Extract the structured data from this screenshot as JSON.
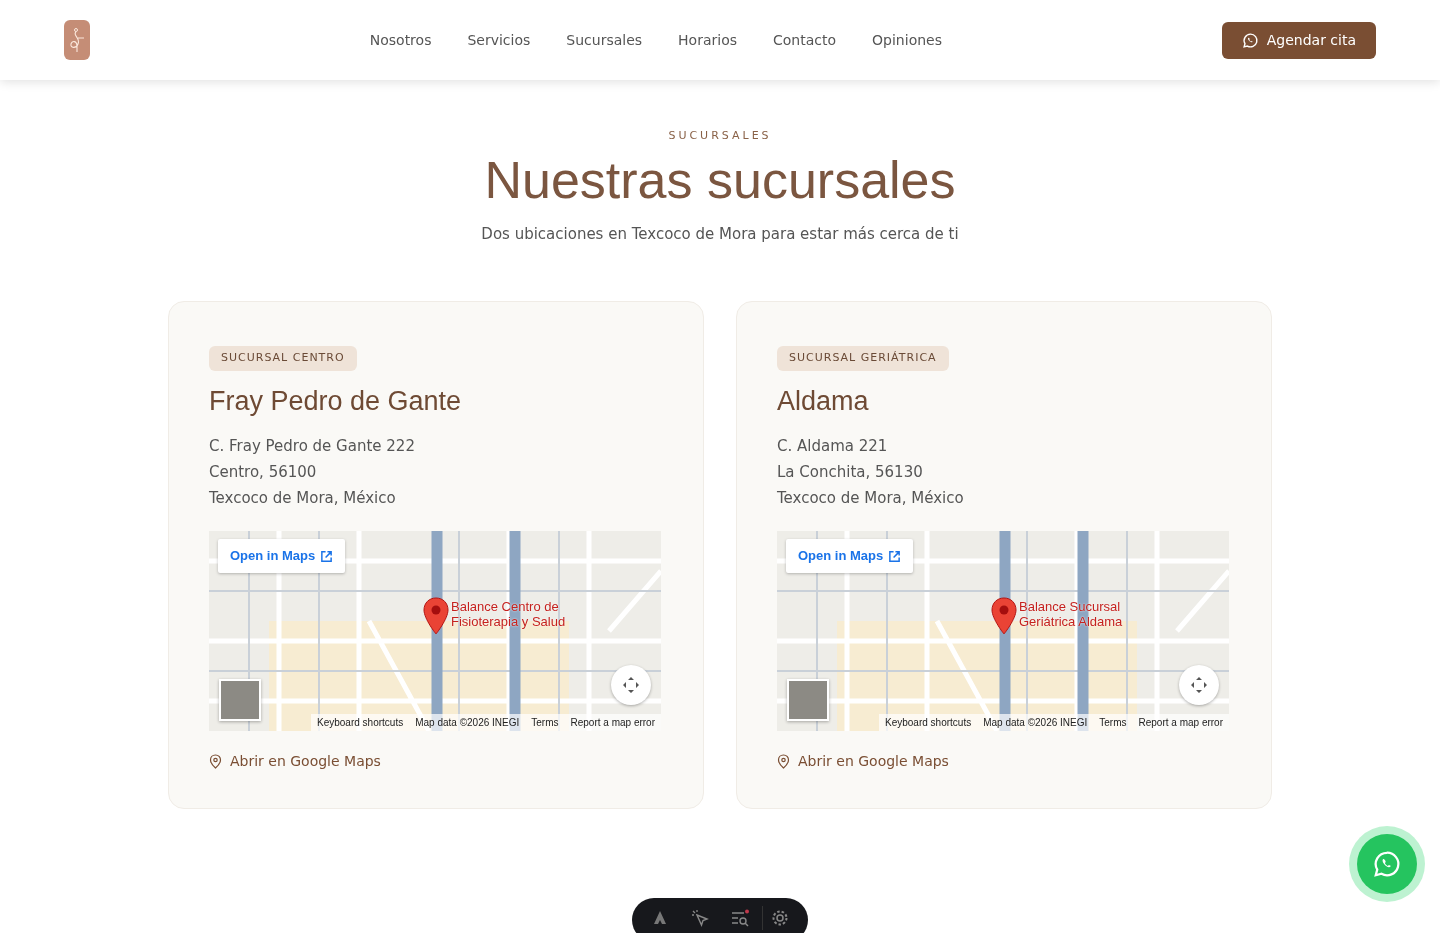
{
  "navbar": {
    "links": [
      {
        "label": "Nosotros"
      },
      {
        "label": "Servicios"
      },
      {
        "label": "Sucursales"
      },
      {
        "label": "Horarios"
      },
      {
        "label": "Contacto"
      },
      {
        "label": "Opiniones"
      }
    ],
    "cta": "Agendar cita"
  },
  "section": {
    "eyebrow": "SUCURSALES",
    "title": "Nuestras sucursales",
    "subtitle": "Dos ubicaciones en Texcoco de Mora para estar más cerca de ti"
  },
  "branches": [
    {
      "badge": "SUCURSAL CENTRO",
      "name": "Fray Pedro de Gante",
      "address": [
        "C. Fray Pedro de Gante 222",
        "Centro, 56100",
        "Texcoco de Mora, México"
      ],
      "map": {
        "open_button": "Open in Maps",
        "marker_label": "Balance Centro de Fisioterapia y Salud",
        "footer": [
          "Keyboard shortcuts",
          "Map data ©2026 INEGI",
          "Terms",
          "Report a map error"
        ]
      },
      "link": "Abrir en Google Maps"
    },
    {
      "badge": "SUCURSAL GERIÁTRICA",
      "name": "Aldama",
      "address": [
        "C. Aldama 221",
        "La Conchita, 56130",
        "Texcoco de Mora, México"
      ],
      "map": {
        "open_button": "Open in Maps",
        "marker_label": "Balance Sucursal Geriátrica Aldama",
        "footer": [
          "Keyboard shortcuts",
          "Map data ©2026 INEGI",
          "Terms",
          "Report a map error"
        ]
      },
      "link": "Abrir en Google Maps"
    }
  ]
}
